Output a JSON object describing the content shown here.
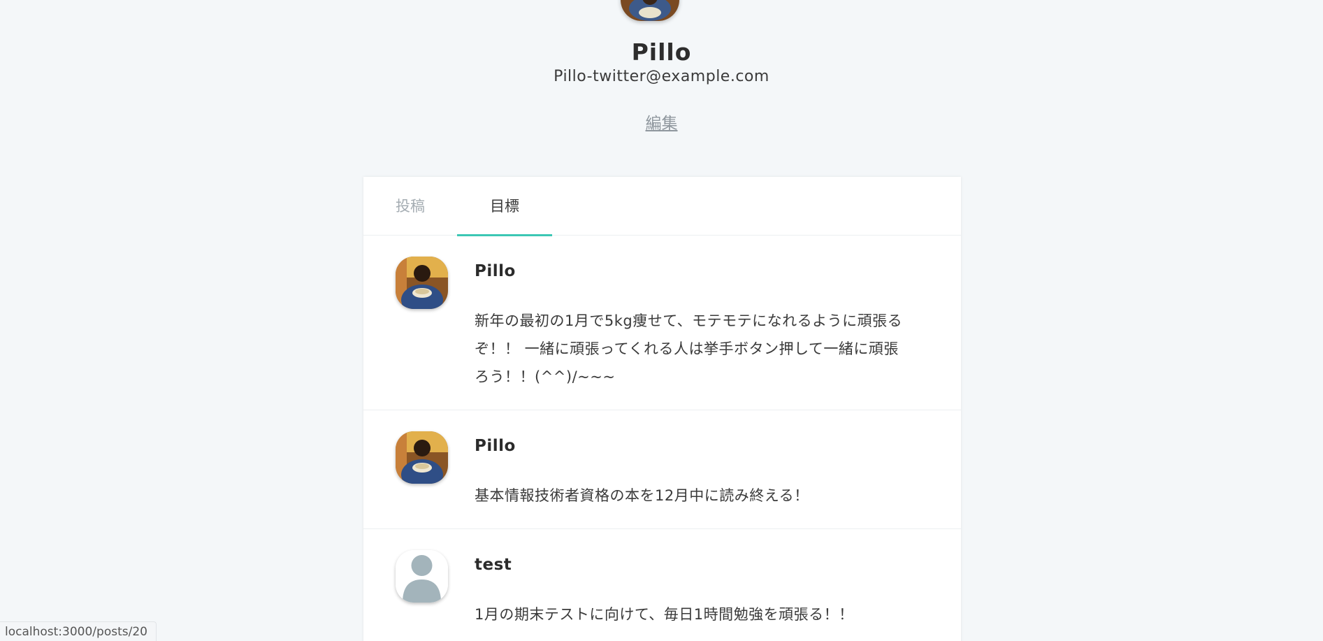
{
  "profile": {
    "name": "Pillo",
    "email": "Pillo-twitter@example.com",
    "edit_label": "編集"
  },
  "tabs": [
    {
      "label": "投稿",
      "active": false
    },
    {
      "label": "目標",
      "active": true
    }
  ],
  "posts": [
    {
      "user": "Pillo",
      "avatar": "photo",
      "lines": [
        "新年の最初の1月で5kg痩せて、モテモテになれるように頑張る",
        "ぞ！！ 一緒に頑張ってくれる人は挙手ボタン押して一緒に頑張",
        "ろう！！(^^)/~~~"
      ]
    },
    {
      "user": "Pillo",
      "avatar": "photo",
      "lines": [
        "基本情報技術者資格の本を12月中に読み終える！"
      ]
    },
    {
      "user": "test",
      "avatar": "default-user-icon",
      "lines": [
        "1月の期末テストに向けて、毎日1時間勉強を頑張る！！"
      ]
    }
  ],
  "status_bar": {
    "url": "localhost:3000/posts/20"
  },
  "colors": {
    "background": "#f4f7f9",
    "accent": "#3cc7b4",
    "muted_text": "#a4acb2",
    "default_avatar": "#a3b4bb"
  }
}
